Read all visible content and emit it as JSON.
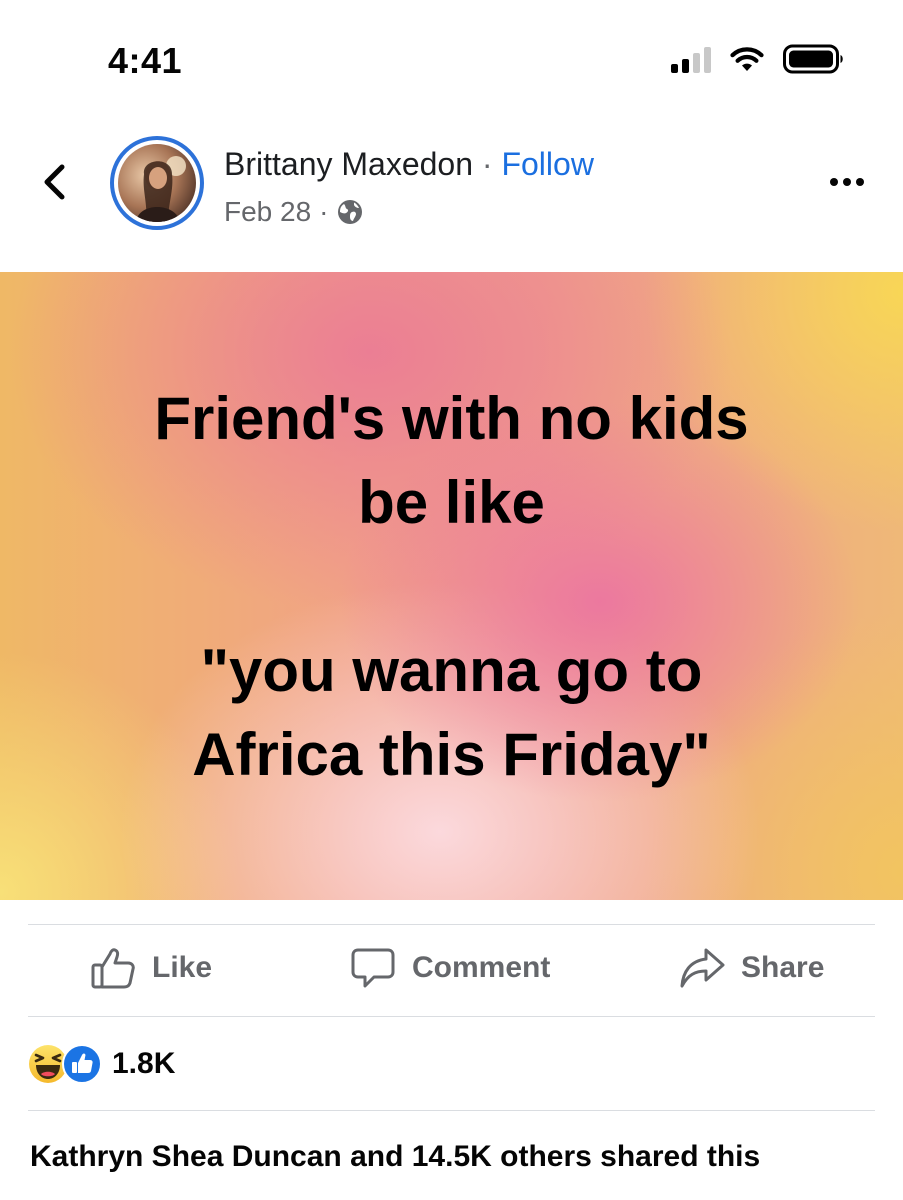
{
  "status_bar": {
    "time": "4:41",
    "icons": [
      "cellular-signal-icon",
      "wifi-icon",
      "battery-icon"
    ]
  },
  "post": {
    "author": "Brittany Maxedon",
    "separator": " · ",
    "follow_label": "Follow",
    "date": "Feb 28",
    "date_separator": "·",
    "audience_icon": "globe-icon",
    "text_lines": {
      "line1": "Friend's with no kids",
      "line2": "be like",
      "line3": "\"you wanna go to",
      "line4": "Africa this Friday\""
    },
    "colors": {
      "accent": "#1b6fe0",
      "avatar_ring": "#2d72d9",
      "secondary_text": "#65676b"
    }
  },
  "actions": {
    "like": "Like",
    "comment": "Comment",
    "share": "Share"
  },
  "reactions": {
    "icons": [
      "laughing-emoji-icon",
      "thumbs-up-reaction-icon"
    ],
    "count": "1.8K"
  },
  "shares": {
    "text": "Kathryn Shea Duncan and 14.5K others shared this"
  }
}
